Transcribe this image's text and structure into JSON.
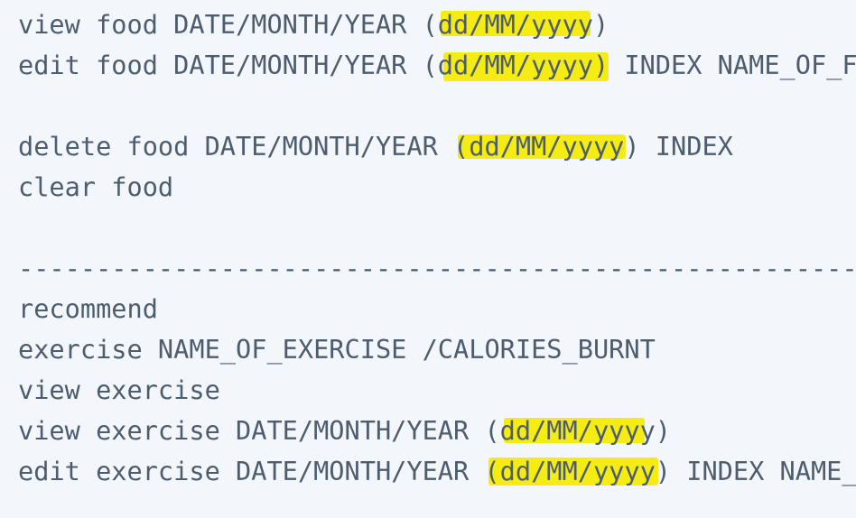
{
  "code_lines": [
    "view food DATE/MONTH/YEAR (dd/MM/yyyy)",
    "edit food DATE/MONTH/YEAR (dd/MM/yyyy) INDEX NAME_OF_F",
    "",
    "delete food DATE/MONTH/YEAR (dd/MM/yyyy) INDEX",
    "clear food",
    "",
    "",
    "------------------------------------------------------",
    "recommend",
    "exercise NAME_OF_EXERCISE /CALORIES_BURNT",
    "view exercise",
    "view exercise DATE/MONTH/YEAR (dd/MM/yyyy)",
    "edit exercise DATE/MONTH/YEAR (dd/MM/yyyy) INDEX NAME_"
  ],
  "highlight_color": "#f5ea00",
  "text_color": "#4d5d6e",
  "background_color": "#f3f6fb"
}
